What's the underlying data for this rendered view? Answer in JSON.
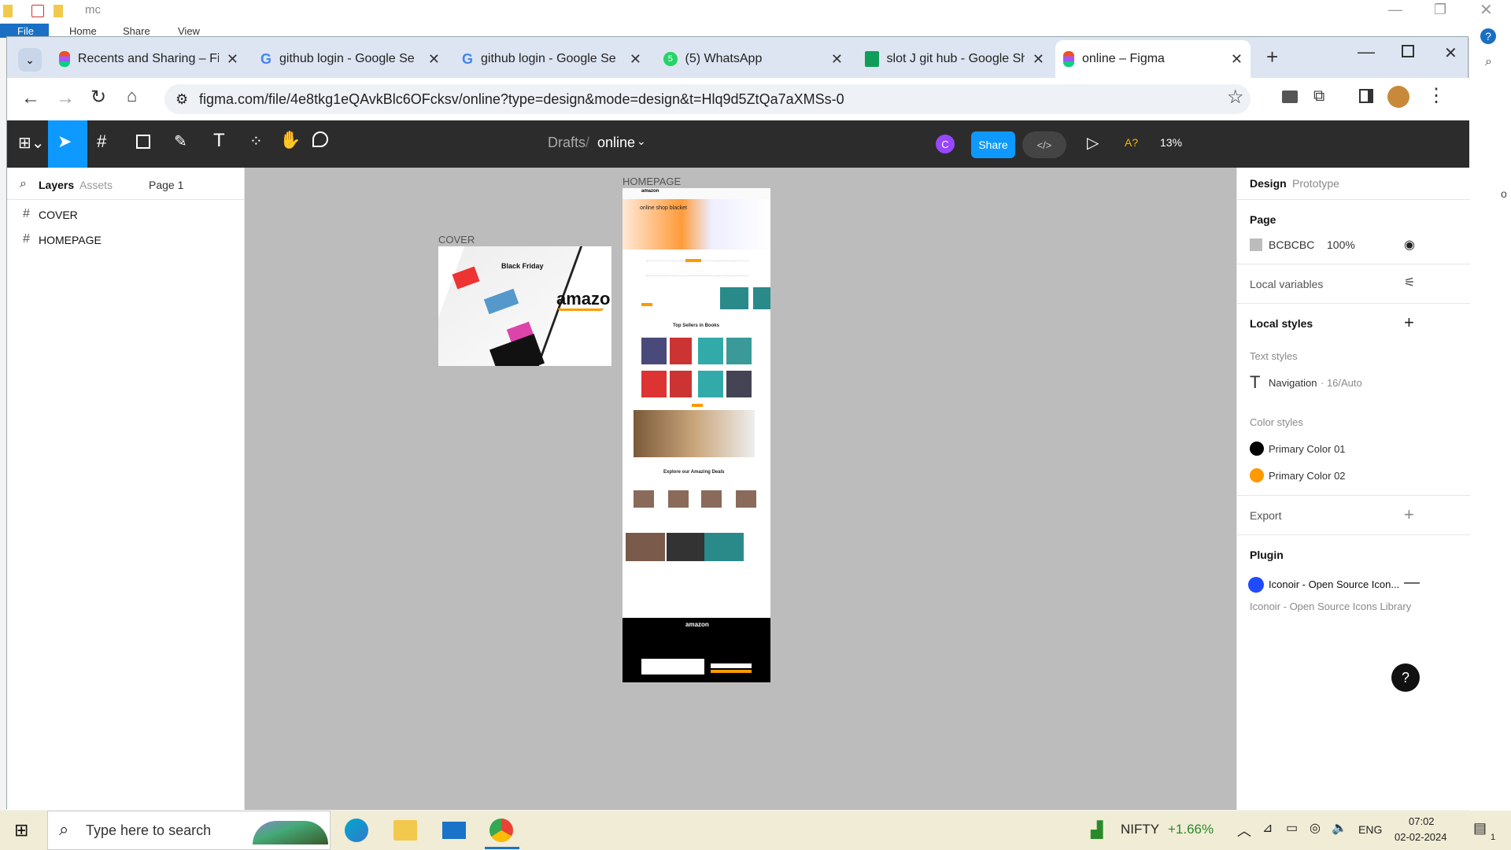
{
  "explorer": {
    "title": "mc",
    "menu": [
      "File",
      "Home",
      "Share",
      "View"
    ]
  },
  "tabs": [
    {
      "label": "Recents and Sharing – Fig",
      "icon": "figma-icon"
    },
    {
      "label": "github login - Google Se",
      "icon": "google-icon"
    },
    {
      "label": "github login - Google Se",
      "icon": "google-icon"
    },
    {
      "label": "(5) WhatsApp",
      "icon": "whatsapp-icon"
    },
    {
      "label": "slot J git hub - Google Sh",
      "icon": "sheets-icon"
    },
    {
      "label": "online – Figma",
      "icon": "figma-icon"
    }
  ],
  "address": {
    "url": "figma.com/file/4e8tkg1eQAvkBlc6OFcksv/online?type=design&mode=design&t=Hlq9d5ZtQa7aXMSs-0"
  },
  "figma": {
    "breadcrumb_parent": "Drafts",
    "breadcrumb_sep": "/",
    "file_name": "online",
    "avatar_letter": "C",
    "share_label": "Share",
    "zoom": "13%",
    "a_label": "A?"
  },
  "layers": {
    "tab_layers": "Layers",
    "tab_assets": "Assets",
    "page": "Page 1",
    "items": [
      "COVER",
      "HOMEPAGE"
    ]
  },
  "canvas": {
    "cover_label": "COVER",
    "homepage_label": "HOMEPAGE",
    "amazon": "amazon",
    "black_friday": "Black Friday",
    "hero_text": "online shop blacket",
    "top_sellers": "Top Sellers in Books",
    "deals": "Explore our Amazing Deals"
  },
  "props": {
    "tab_design": "Design",
    "tab_prototype": "Prototype",
    "page_title": "Page",
    "page_color": "BCBCBC",
    "page_opacity": "100%",
    "local_variables": "Local variables",
    "local_styles": "Local styles",
    "text_styles": "Text styles",
    "nav_style": "Navigation",
    "nav_meta": " · 16/Auto",
    "color_styles": "Color styles",
    "color1": "Primary Color 01",
    "color2": "Primary Color 02",
    "export": "Export",
    "plugin": "Plugin",
    "plugin_name": "Iconoir - Open Source Icon...",
    "plugin_sub": "Iconoir - Open Source Icons Library",
    "help": "?"
  },
  "colors": {
    "accent": "#0d99ff",
    "primary1": "#000000",
    "primary2": "#ff9900",
    "canvas": "#BCBCBC"
  },
  "taskbar": {
    "search": "Type here to search",
    "nifty": "NIFTY",
    "nifty_change": "+1.66%",
    "lang": "ENG",
    "time": "07:02",
    "date": "02-02-2024",
    "notif": "1"
  }
}
